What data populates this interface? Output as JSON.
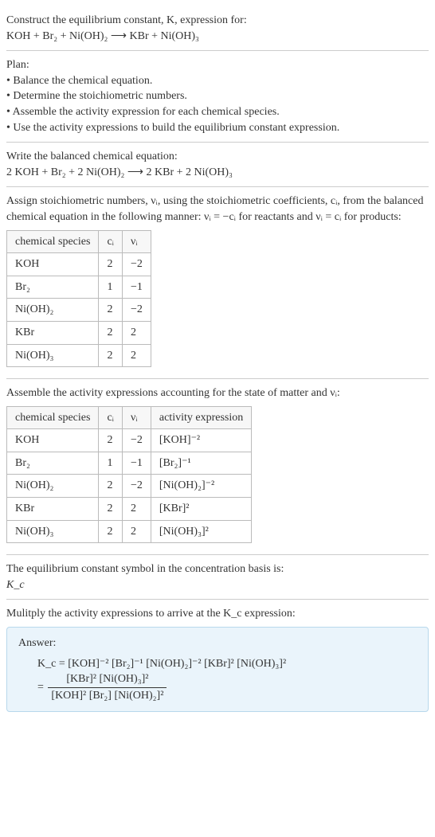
{
  "title_line1": "Construct the equilibrium constant, K, expression for:",
  "title_eq": "KOH + Br₂ + Ni(OH)₂  ⟶  KBr + Ni(OH)₃",
  "plan_heading": "Plan:",
  "plan_items": [
    "• Balance the chemical equation.",
    "• Determine the stoichiometric numbers.",
    "• Assemble the activity expression for each chemical species.",
    "• Use the activity expressions to build the equilibrium constant expression."
  ],
  "balanced_heading": "Write the balanced chemical equation:",
  "balanced_eq": "2 KOH + Br₂ + 2 Ni(OH)₂  ⟶  2 KBr + 2 Ni(OH)₃",
  "assign_text_a": "Assign stoichiometric numbers, νᵢ, using the stoichiometric coefficients, cᵢ, from the balanced chemical equation in the following manner: νᵢ = −cᵢ for reactants and νᵢ = cᵢ for products:",
  "table1_headers": [
    "chemical species",
    "cᵢ",
    "νᵢ"
  ],
  "table1_rows": [
    [
      "KOH",
      "2",
      "−2"
    ],
    [
      "Br₂",
      "1",
      "−1"
    ],
    [
      "Ni(OH)₂",
      "2",
      "−2"
    ],
    [
      "KBr",
      "2",
      "2"
    ],
    [
      "Ni(OH)₃",
      "2",
      "2"
    ]
  ],
  "assemble_text": "Assemble the activity expressions accounting for the state of matter and νᵢ:",
  "table2_headers": [
    "chemical species",
    "cᵢ",
    "νᵢ",
    "activity expression"
  ],
  "table2_rows": [
    [
      "KOH",
      "2",
      "−2",
      "[KOH]⁻²"
    ],
    [
      "Br₂",
      "1",
      "−1",
      "[Br₂]⁻¹"
    ],
    [
      "Ni(OH)₂",
      "2",
      "−2",
      "[Ni(OH)₂]⁻²"
    ],
    [
      "KBr",
      "2",
      "2",
      "[KBr]²"
    ],
    [
      "Ni(OH)₃",
      "2",
      "2",
      "[Ni(OH)₃]²"
    ]
  ],
  "kconst_text": "The equilibrium constant symbol in the concentration basis is:",
  "kconst_symbol": "K_c",
  "multiply_text": "Mulitply the activity expressions to arrive at the K_c expression:",
  "answer_label": "Answer:",
  "answer_line1": "K_c = [KOH]⁻² [Br₂]⁻¹ [Ni(OH)₂]⁻² [KBr]² [Ni(OH)₃]²",
  "answer_frac_num": "[KBr]² [Ni(OH)₃]²",
  "answer_frac_den": "[KOH]² [Br₂] [Ni(OH)₂]²",
  "chart_data": {
    "type": "table",
    "tables": [
      {
        "title": "stoichiometric numbers",
        "headers": [
          "chemical species",
          "c_i",
          "nu_i"
        ],
        "rows": [
          {
            "chemical species": "KOH",
            "c_i": 2,
            "nu_i": -2
          },
          {
            "chemical species": "Br2",
            "c_i": 1,
            "nu_i": -1
          },
          {
            "chemical species": "Ni(OH)2",
            "c_i": 2,
            "nu_i": -2
          },
          {
            "chemical species": "KBr",
            "c_i": 2,
            "nu_i": 2
          },
          {
            "chemical species": "Ni(OH)3",
            "c_i": 2,
            "nu_i": 2
          }
        ]
      },
      {
        "title": "activity expressions",
        "headers": [
          "chemical species",
          "c_i",
          "nu_i",
          "activity expression"
        ],
        "rows": [
          {
            "chemical species": "KOH",
            "c_i": 2,
            "nu_i": -2,
            "activity expression": "[KOH]^-2"
          },
          {
            "chemical species": "Br2",
            "c_i": 1,
            "nu_i": -1,
            "activity expression": "[Br2]^-1"
          },
          {
            "chemical species": "Ni(OH)2",
            "c_i": 2,
            "nu_i": -2,
            "activity expression": "[Ni(OH)2]^-2"
          },
          {
            "chemical species": "KBr",
            "c_i": 2,
            "nu_i": 2,
            "activity expression": "[KBr]^2"
          },
          {
            "chemical species": "Ni(OH)3",
            "c_i": 2,
            "nu_i": 2,
            "activity expression": "[Ni(OH)3]^2"
          }
        ]
      }
    ]
  }
}
